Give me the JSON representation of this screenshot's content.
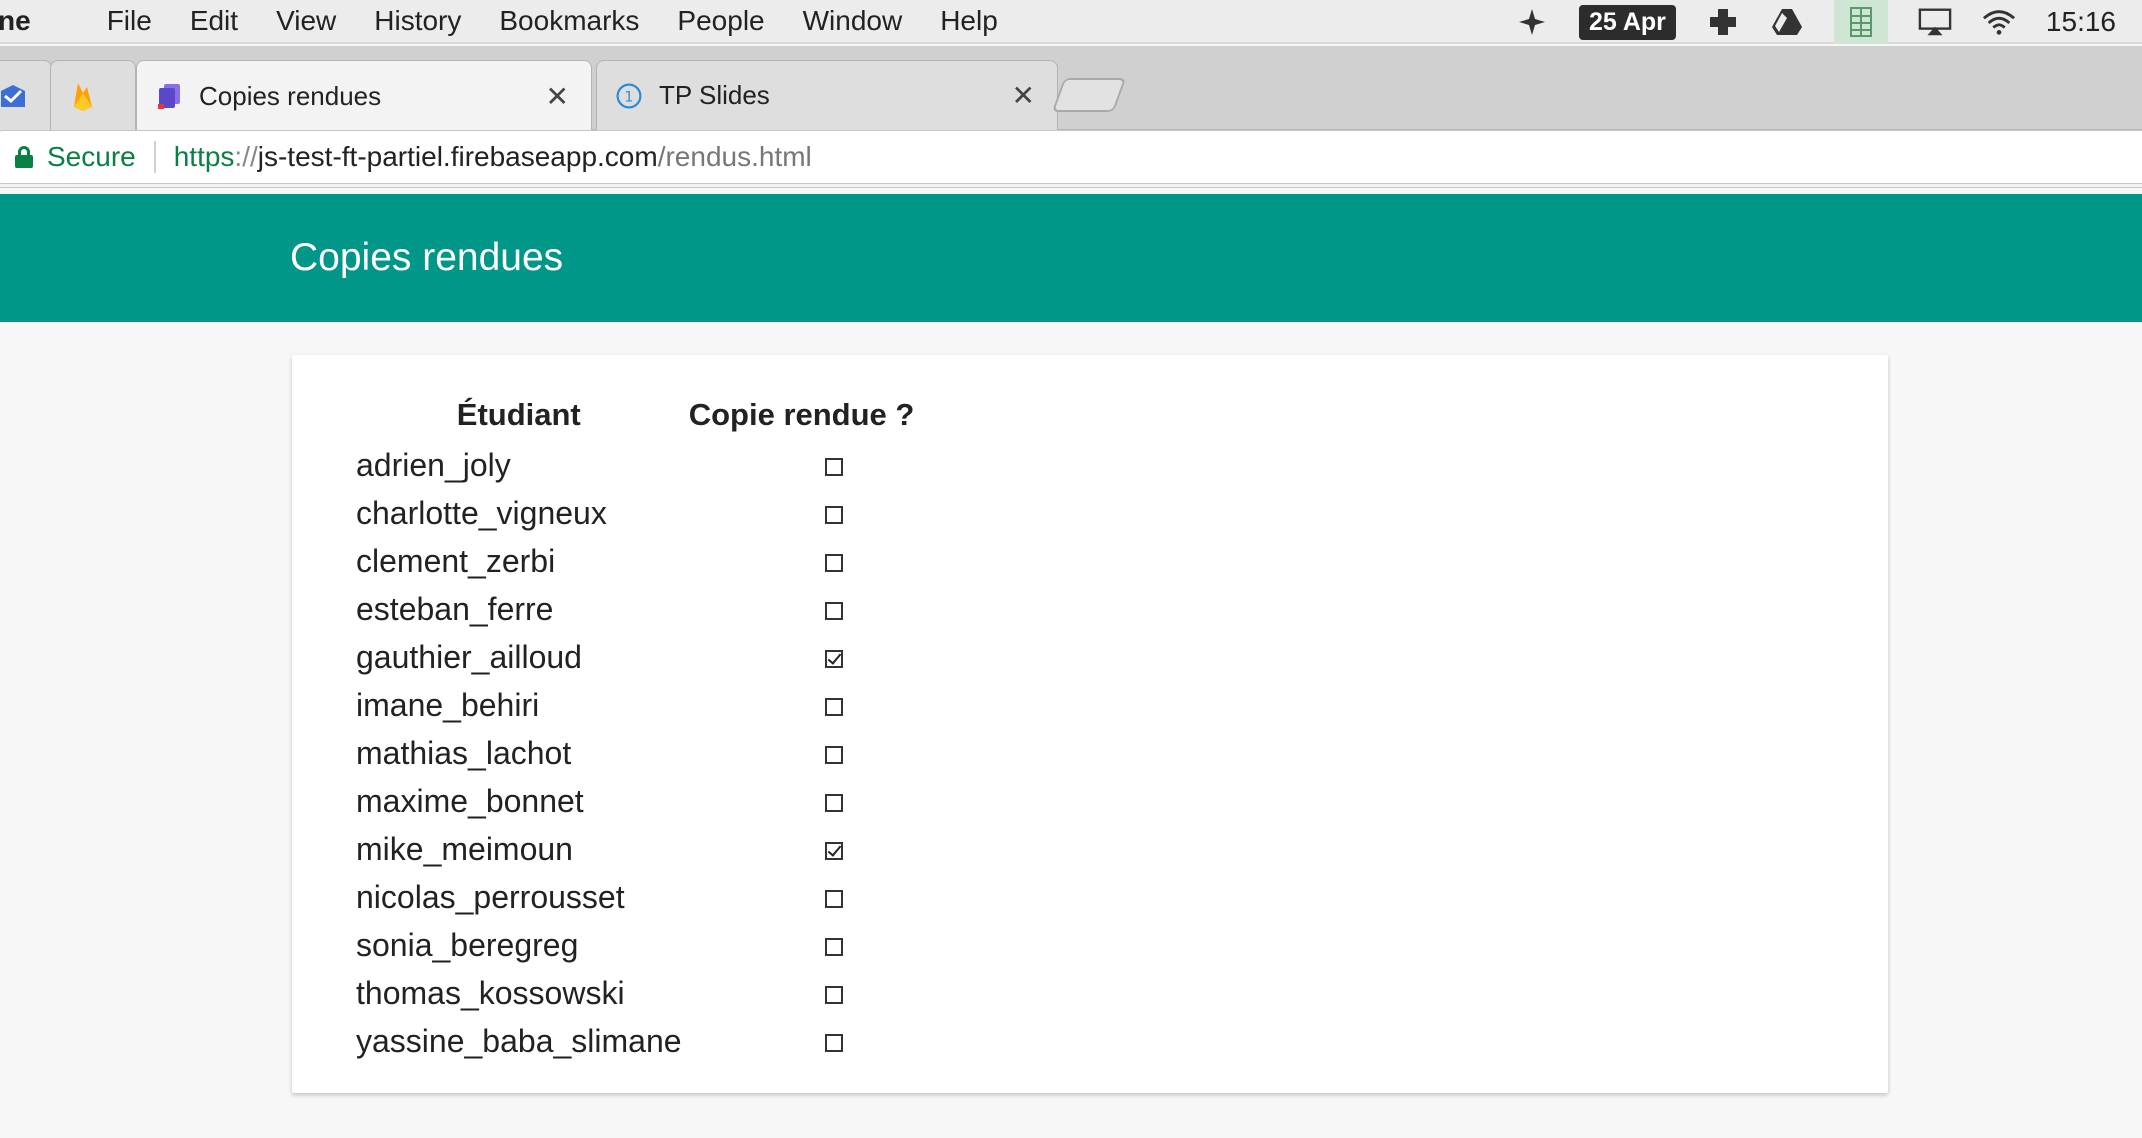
{
  "menubar": {
    "app_name": "ne",
    "items": [
      "File",
      "Edit",
      "View",
      "History",
      "Bookmarks",
      "People",
      "Window",
      "Help"
    ],
    "date": "25 Apr",
    "time": "15:16"
  },
  "tabs": [
    {
      "title": "",
      "icon": "inbox-icon"
    },
    {
      "title": "",
      "icon": "firebase-icon"
    },
    {
      "title": "Copies rendues",
      "icon": "copies-icon",
      "active": true
    },
    {
      "title": "TP Slides",
      "icon": "slides-icon",
      "favicon_text": "1"
    }
  ],
  "address": {
    "secure_label": "Secure",
    "scheme": "https",
    "separator": "://",
    "host": "js-test-ft-partiel.firebaseapp.com",
    "path": "/rendus.html"
  },
  "header": {
    "title": "Copies rendues"
  },
  "table": {
    "headers": {
      "student": "Étudiant",
      "submitted": "Copie rendue ?"
    },
    "rows": [
      {
        "student": "adrien_joly",
        "submitted": false
      },
      {
        "student": "charlotte_vigneux",
        "submitted": false
      },
      {
        "student": "clement_zerbi",
        "submitted": false
      },
      {
        "student": "esteban_ferre",
        "submitted": false
      },
      {
        "student": "gauthier_ailloud",
        "submitted": true
      },
      {
        "student": "imane_behiri",
        "submitted": false
      },
      {
        "student": "mathias_lachot",
        "submitted": false
      },
      {
        "student": "maxime_bonnet",
        "submitted": false
      },
      {
        "student": "mike_meimoun",
        "submitted": true
      },
      {
        "student": "nicolas_perrousset",
        "submitted": false
      },
      {
        "student": "sonia_beregreg",
        "submitted": false
      },
      {
        "student": "thomas_kossowski",
        "submitted": false
      },
      {
        "student": "yassine_baba_slimane",
        "submitted": false
      }
    ]
  },
  "colors": {
    "header_bg": "#009688",
    "secure_green": "#0b8043"
  }
}
